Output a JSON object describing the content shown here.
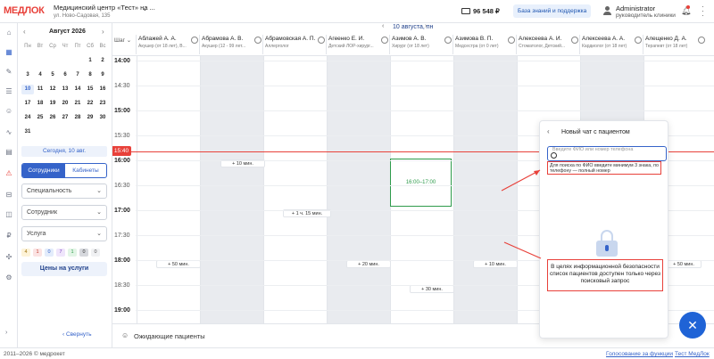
{
  "header": {
    "logo": "МЕДЛОК",
    "clinic_name": "Медицинский центр «Тест» на ...",
    "clinic_address": "ул. Ново-Садовая, 135",
    "balance": "96 548 ₽",
    "kb_button": "База знаний и поддержка",
    "user_name": "Administrator",
    "user_role": "руководитель клиники"
  },
  "calendar": {
    "month": "Август 2026",
    "dow": [
      "Пн",
      "Вт",
      "Ср",
      "Чт",
      "Пт",
      "Сб",
      "Вс"
    ],
    "weeks": [
      [
        "",
        "",
        "",
        "",
        "",
        "1",
        "2"
      ],
      [
        "3",
        "4",
        "5",
        "6",
        "7",
        "8",
        "9"
      ],
      [
        "10",
        "11",
        "12",
        "13",
        "14",
        "15",
        "16"
      ],
      [
        "17",
        "18",
        "19",
        "20",
        "21",
        "22",
        "23"
      ],
      [
        "24",
        "25",
        "26",
        "27",
        "28",
        "29",
        "30"
      ],
      [
        "31",
        "",
        "",
        "",
        "",
        "",
        ""
      ]
    ],
    "today_button": "Сегодня, 10 авг.",
    "tab_staff": "Сотрудники",
    "tab_rooms": "Кабинеты",
    "filter_specialty": "Специальность",
    "filter_employee": "Сотрудник",
    "filter_service": "Услуга",
    "badges": [
      "4",
      "1",
      "0",
      "7",
      "1",
      "0",
      "0"
    ],
    "prices_button": "Цены на услуги",
    "collapse": "Свернуть"
  },
  "schedule": {
    "date": "10 августа, пн",
    "step_label": "Шаг",
    "doctors": [
      {
        "name": "Аблажей А. А.",
        "spec": "Акушер (от 18 лет), В..."
      },
      {
        "name": "Абрамова А. В.",
        "spec": "Акушер (12 - 99 лет..."
      },
      {
        "name": "Абрамовская А. П.",
        "spec": "Аллерголог"
      },
      {
        "name": "Агеенко Е. И.",
        "spec": "Детский ЛОР-хирург..."
      },
      {
        "name": "Азимов А. В.",
        "spec": "Хирург (от 18 лет)"
      },
      {
        "name": "Азимова В. П.",
        "spec": "Медсестра (от 0 лет)"
      },
      {
        "name": "Алексеева А. И.",
        "spec": "Стоматолог, Детский..."
      },
      {
        "name": "Алексеева А. А.",
        "spec": "Кардиолог (от 18 лет)"
      },
      {
        "name": "Алещенко Д. А.",
        "spec": "Терапевт (от 18 лет)"
      }
    ],
    "times": [
      "14:00",
      "14:30",
      "15:00",
      "15:30",
      "16:00",
      "16:30",
      "17:00",
      "17:30",
      "18:00",
      "18:30",
      "19:00"
    ],
    "now_time": "15:40",
    "pills": {
      "p1": "+ 10 мин.",
      "p2": "+ 1 ч. 15 мин.",
      "p3": "+ 50 мин.",
      "p4": "+ 20 мин.",
      "p5": "+ 10 мин.",
      "p6": "+ 30 мин.",
      "p7": "+ 50 мин."
    },
    "booked_slot": "16:00–17:00",
    "waiting": "Ожидающие пациенты"
  },
  "chat": {
    "title": "Новый чат с пациентом",
    "search_placeholder": "Введите ФИО или номер телефона",
    "hint": "Для поиска по ФИО введите минимум 3 знака, по телефону — полный номер",
    "security_note": "В целях информационной безопасности список пациентов доступен только через поисковый запрос"
  },
  "footer": {
    "copyright": "2011–2026 © медрокет",
    "link_features": "Голосование за функции",
    "link_test": "Тест МедЛок"
  },
  "colors": {
    "accent": "#3563c9",
    "brand": "#e8413a",
    "now_line": "#e8413a",
    "booked": "#2e9b4b",
    "fab": "#1f63d6"
  }
}
